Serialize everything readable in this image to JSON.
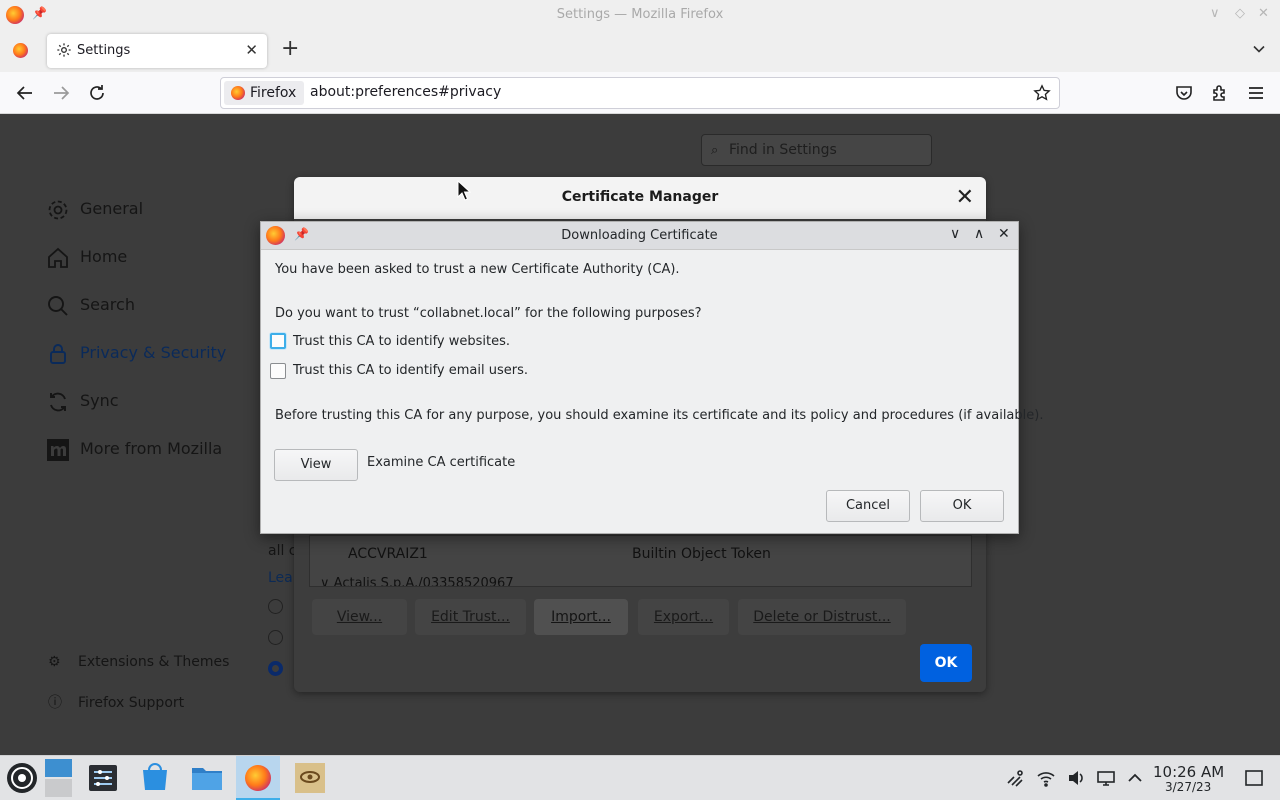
{
  "window": {
    "title": "Settings — Mozilla Firefox"
  },
  "tabs": [
    {
      "label": "Settings"
    }
  ],
  "urlbar": {
    "identity_label": "Firefox",
    "url": "about:preferences#privacy"
  },
  "settings": {
    "find_placeholder": "Find in Settings",
    "categories": [
      {
        "label": "General",
        "icon": "gear-icon"
      },
      {
        "label": "Home",
        "icon": "home-icon"
      },
      {
        "label": "Search",
        "icon": "search-icon"
      },
      {
        "label": "Privacy & Security",
        "icon": "lock-icon",
        "active": true
      },
      {
        "label": "Sync",
        "icon": "sync-icon"
      },
      {
        "label": "More from Mozilla",
        "icon": "mozilla-icon"
      }
    ],
    "footer_links": [
      {
        "label": "Extensions & Themes",
        "icon": "puzzle-icon"
      },
      {
        "label": "Firefox Support",
        "icon": "help-icon"
      }
    ],
    "partial_text": [
      "all c",
      "Lea"
    ]
  },
  "cert_manager": {
    "title": "Certificate Manager",
    "list_rows": [
      {
        "name": "ACCVRAIZ1",
        "device": "Builtin Object Token"
      },
      {
        "name": "Actalis S.p.A./03358520967",
        "device": ""
      }
    ],
    "buttons": [
      "View...",
      "Edit Trust...",
      "Import...",
      "Export...",
      "Delete or Distrust..."
    ],
    "ok_label": "OK"
  },
  "download_dialog": {
    "title": "Downloading Certificate",
    "intro": "You have been asked to trust a new Certificate Authority (CA).",
    "question": "Do you want to trust “collabnet.local” for the following purposes?",
    "checkboxes": [
      {
        "label": "Trust this CA to identify websites.",
        "checked": false,
        "focused": true
      },
      {
        "label": "Trust this CA to identify email users.",
        "checked": false,
        "focused": false
      }
    ],
    "advice": "Before trusting this CA for any purpose, you should examine its certificate and its policy and procedures (if available).",
    "view_button": "View",
    "view_description": "Examine CA certificate",
    "cancel_label": "Cancel",
    "ok_label": "OK"
  },
  "taskbar": {
    "time": "10:26 AM",
    "date": "3/27/23"
  },
  "colors": {
    "accent": "#0061e0",
    "kde_focus": "#3daee9"
  }
}
